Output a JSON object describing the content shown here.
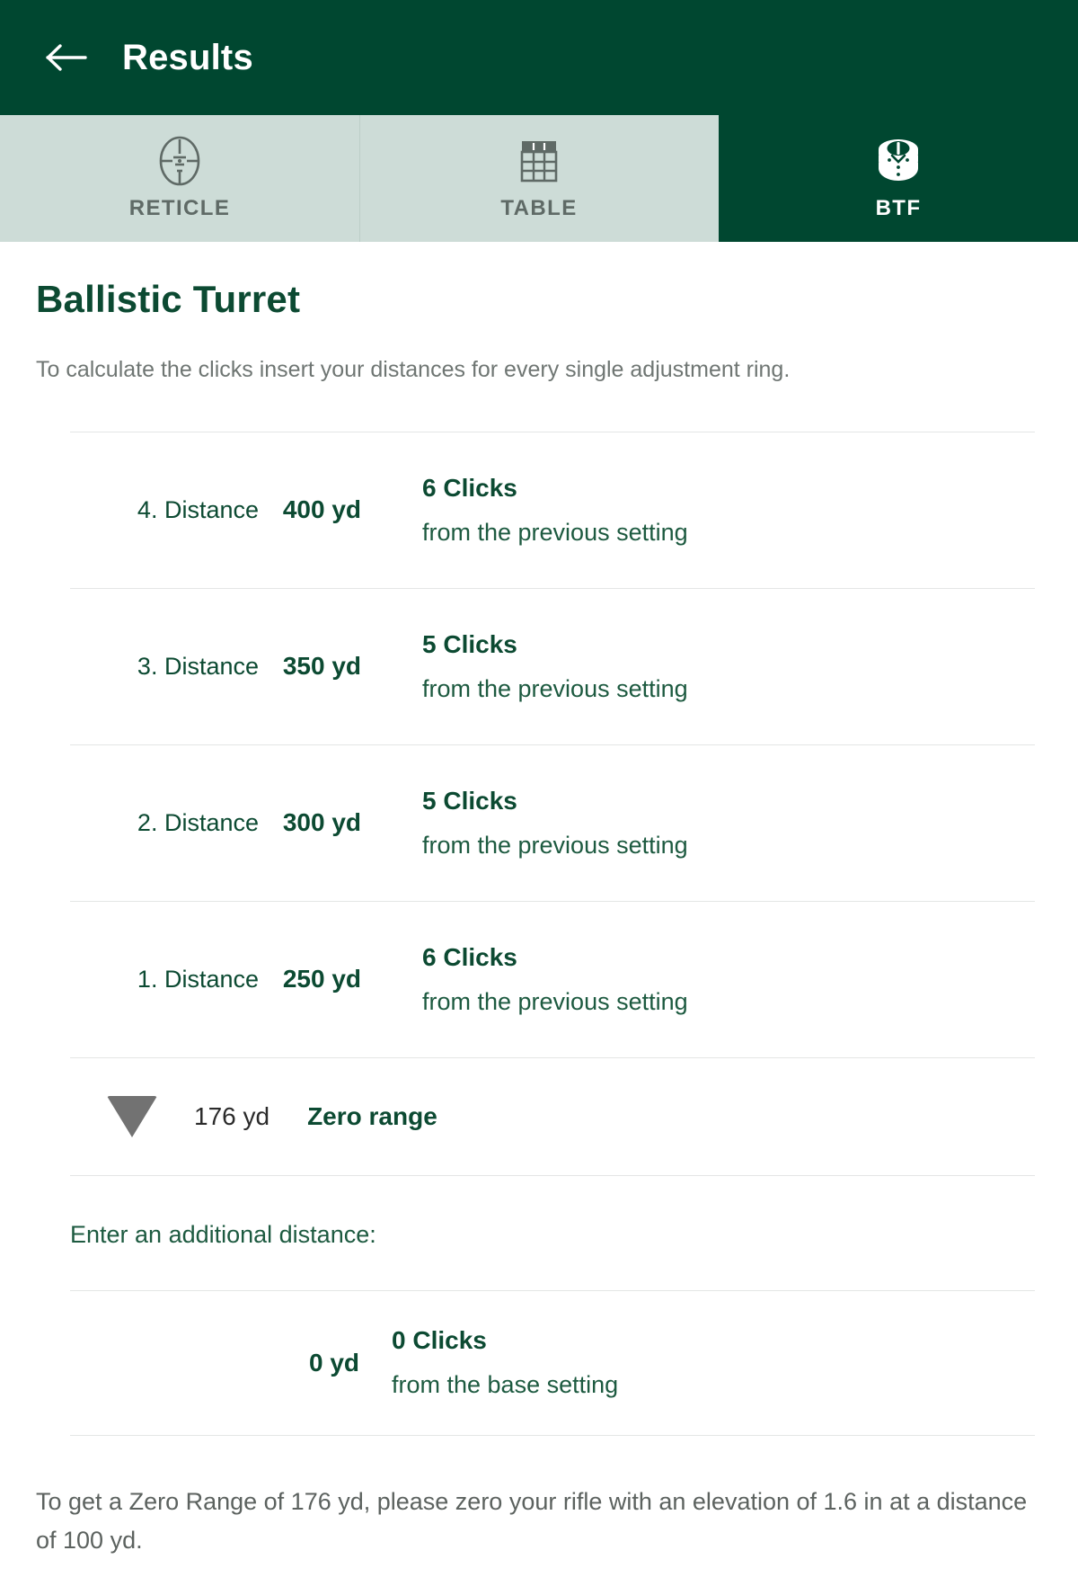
{
  "header": {
    "title": "Results",
    "back_icon": "arrow-left-icon",
    "bg_color": "#004730"
  },
  "tabs": [
    {
      "id": "reticle",
      "label": "RETICLE",
      "icon": "reticle-icon",
      "active": false
    },
    {
      "id": "table",
      "label": "TABLE",
      "icon": "table-icon",
      "active": false
    },
    {
      "id": "btf",
      "label": "BTF",
      "icon": "turret-stack-icon",
      "active": true
    }
  ],
  "main": {
    "title": "Ballistic Turret",
    "subtitle": "To calculate the clicks insert your distances for every single adjustment ring.",
    "rows": [
      {
        "label": "4. Distance",
        "distance": "400 yd",
        "clicks": "6 Clicks",
        "note": "from the previous setting"
      },
      {
        "label": "3. Distance",
        "distance": "350 yd",
        "clicks": "5 Clicks",
        "note": "from the previous setting"
      },
      {
        "label": "2. Distance",
        "distance": "300 yd",
        "clicks": "5 Clicks",
        "note": "from the previous setting"
      },
      {
        "label": "1. Distance",
        "distance": "250 yd",
        "clicks": "6 Clicks",
        "note": "from the previous setting"
      }
    ],
    "zero": {
      "marker_icon": "triangle-down-icon",
      "distance": "176 yd",
      "label": "Zero range"
    },
    "additional": {
      "prompt": "Enter an additional distance:",
      "distance": "0 yd",
      "clicks": "0 Clicks",
      "note": "from the base setting"
    },
    "footer_note": "To get a Zero Range of 176 yd, please zero your rifle with an elevation of 1.6 in at a distance of 100 yd."
  },
  "colors": {
    "brand_green": "#004730",
    "text_green": "#0c4a32",
    "tab_inactive_bg": "#cddcd7",
    "muted": "#6f7673"
  }
}
